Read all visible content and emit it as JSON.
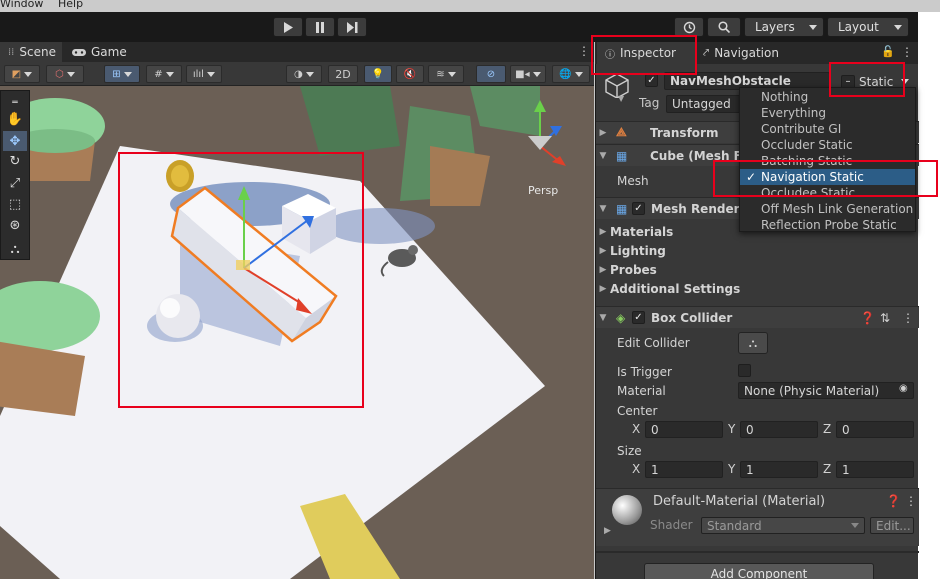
{
  "menubar": {
    "items": [
      "Window",
      "Help"
    ]
  },
  "toolbar": {
    "layers_label": "Layers",
    "layout_label": "Layout"
  },
  "scene_tabs": {
    "scene": "Scene",
    "game": "Game",
    "mode_2d": "2D"
  },
  "scene_view": {
    "persp_label": "Persp"
  },
  "inspector_tabs": {
    "inspector": "Inspector",
    "navigation": "Navigation"
  },
  "object": {
    "name": "NavMeshObstacle",
    "static_label": "Static",
    "tag_label": "Tag",
    "tag_value": "Untagged"
  },
  "static_menu": {
    "items": [
      {
        "label": "Nothing",
        "checked": false
      },
      {
        "label": "Everything",
        "checked": false
      },
      {
        "label": "Contribute GI",
        "checked": false
      },
      {
        "label": "Occluder Static",
        "checked": false
      },
      {
        "label": "Batching Static",
        "checked": false
      },
      {
        "label": "Navigation Static",
        "checked": true
      },
      {
        "label": "Occludee Static",
        "checked": false
      },
      {
        "label": "Off Mesh Link Generation",
        "checked": false
      },
      {
        "label": "Reflection Probe Static",
        "checked": false
      }
    ],
    "check_glyph": "✓"
  },
  "components": {
    "transform": "Transform",
    "mesh_filter": "Cube (Mesh Fi",
    "mesh_label": "Mesh",
    "mesh_renderer": "Mesh Rendere",
    "materials": "Materials",
    "lighting": "Lighting",
    "probes": "Probes",
    "additional_settings": "Additional Settings",
    "box_collider": "Box Collider",
    "edit_collider": "Edit Collider",
    "is_trigger": "Is Trigger",
    "material_label": "Material",
    "material_value": "None (Physic Material)",
    "center_label": "Center",
    "size_label": "Size",
    "center": {
      "x": "0",
      "y": "0",
      "z": "0"
    },
    "size": {
      "x": "1",
      "y": "1",
      "z": "1"
    },
    "axis_x": "X",
    "axis_y": "Y",
    "axis_z": "Z",
    "default_material": "Default-Material (Material)",
    "shader_label": "Shader",
    "shader_value": "Standard",
    "edit_button": "Edit...",
    "add_component": "Add Component"
  },
  "colors": {
    "highlight_red": "#e8001c",
    "selection_blue": "#2c5d87",
    "editor_bg": "#383838"
  }
}
